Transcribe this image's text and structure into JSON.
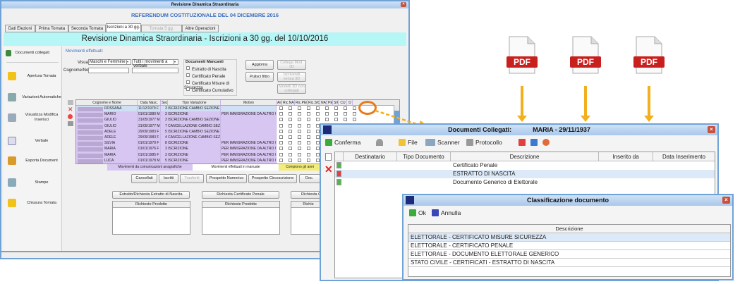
{
  "main_window": {
    "title": "Revisione Dinamica Straordinaria",
    "header": "REFERENDUM COSTITUZIONALE DEL 04 DICEMBRE 2016",
    "tabs": [
      "Dati Elezioni",
      "Prima Tornata",
      "Seconda Tornata",
      "Iscrizioni a 30 gg.",
      "Tornata 5 gg.",
      "Altre Operazioni"
    ],
    "banner": "Revisione Dinamica Straordinaria - Iscrizioni a 30 gg. del 10/10/2016",
    "sidebar": [
      "Documenti collegati",
      "Apertura Tornata",
      "Variazioni Automatiche",
      "Visualizza Modifica Inserisci",
      "Verbale",
      "Esporta Document",
      "Stampe",
      "Chiusura Tornata"
    ],
    "section_title": "Movimenti effettuati:",
    "filters": {
      "visualizza_label": "Visualizza:",
      "visualizza_value": "Maschi e Femmine",
      "movimenti_value": "Tutti i movimenti a verbale",
      "name_label": "Cognome/Nome"
    },
    "missing_docs": {
      "title": "Documenti Mancanti",
      "items": [
        "Estratto di Nascita",
        "Certificato Penale",
        "Certificato Misure di Sicurezza",
        "Certificato Cumulativo"
      ]
    },
    "buttons": {
      "aggiorna": "Aggiorna",
      "pulisci": "Pulisci filtro",
      "collega": "Collega Mod. 3D",
      "iscrivendi": "Iscrivendi senza 3D",
      "modelli": "Modelli 3D non collegati"
    },
    "grid": {
      "columns": [
        "Cognome e Nome",
        "Data Nasc.",
        "Sez.",
        "Tipo Variazione",
        "Motivo",
        "Aire",
        "Ric.NAS",
        "Ric.PEN",
        "Ric.SIC",
        "NAS",
        "PEN",
        "SIC",
        "CU",
        "D"
      ],
      "rows": [
        [
          "ROSSANA",
          "11/12/1979 F",
          "3 ISCRIZIONE CAMBIO SEZIONE",
          ""
        ],
        [
          "MARIO",
          "01/01/1980 M",
          "3 ISCRIZIONE",
          "PER IMMIGRAZIONE DA ALTRO COMU"
        ],
        [
          "GIULIO",
          "31/05/1977 M",
          "3 ISCRIZIONE CAMBIO SEZIONE",
          ""
        ],
        [
          "GIULIO",
          "31/05/1977 M",
          "7 CANCELLAZIONE CAMBIO SEZIONE",
          ""
        ],
        [
          "ADELE",
          "29/09/1983 F",
          "5 ISCRIZIONE CAMBIO SEZIONE",
          ""
        ],
        [
          "ADELE",
          "29/09/1983 F",
          "4 CANCELLAZIONE CAMBIO SEZIONE",
          ""
        ],
        [
          "SILVIA",
          "01/01/1979 F",
          "8 ISCRIZIONE",
          "PER IMMIGRAZIONE DA ALTRO COMU"
        ],
        [
          "MARIA",
          "01/01/1976 F",
          "3 ISCRIZIONE",
          "PER IMMIGRAZIONE DA ALTRO COMU"
        ],
        [
          "MARIA",
          "01/01/1985 F",
          "3 ISCRIZIONE",
          "PER IMMIGRAZIONE DA ALTRO COMU"
        ],
        [
          "LUCA",
          "01/01/1978 M",
          "5 ISCRIZIONE",
          "PER IMMIGRAZIONE DA ALTRO COMU"
        ]
      ]
    },
    "legend": [
      "Movimenti da comunicazioni anagrafiche",
      "Movimenti effettuati in manuale",
      "Compiono gli anni"
    ],
    "actions": [
      "Cancellati",
      "Iscritti",
      "Trasferiti",
      "Prospetto Numerico",
      "Prospetto Circoscrizione",
      "Doc."
    ],
    "requests": [
      {
        "button": "Estratto/Richiesta Estratto di Nascita",
        "list_header": "Richieste Prodotte"
      },
      {
        "button": "Richiesta Certificato Penale",
        "list_header": "Richieste Prodotte"
      },
      {
        "button": "Richiesta C",
        "list_header": "Richie"
      }
    ]
  },
  "pdf_icons": [
    "PDF",
    "PDF",
    "PDF"
  ],
  "docs_dialog": {
    "title": "Documenti Collegati:            MARIA - 29/11/1937",
    "toolbar": [
      "Conferma",
      "File",
      "Scanner",
      "Protocollo"
    ],
    "columns": [
      "Destinatario",
      "Tipo Documento",
      "Descrizione",
      "Inserito da",
      "Data Inserimento"
    ],
    "rows": [
      "Certificato Penale",
      "ESTRATTO DI NASCITA",
      "Documento Generico di Elettorale"
    ]
  },
  "class_dialog": {
    "title": "Classificazione documento",
    "toolbar": [
      "Ok",
      "Annulla"
    ],
    "column": "Descrizione",
    "rows": [
      "ELETTORALE - CERTIFICATO MISURE SICUREZZA",
      "ELETTORALE - CERTIFICATO PENALE",
      "ELETTORALE - DOCUMENTO ELETTORALE GENERICO",
      "STATO CIVILE - CERTIFICATI - ESTRATTO DI NASCITA"
    ]
  },
  "colors": {
    "banner": "#b6f6f6",
    "purple_row": "#d8c6f2",
    "accent": "#f2b01e",
    "pdf_red": "#c8201e"
  }
}
